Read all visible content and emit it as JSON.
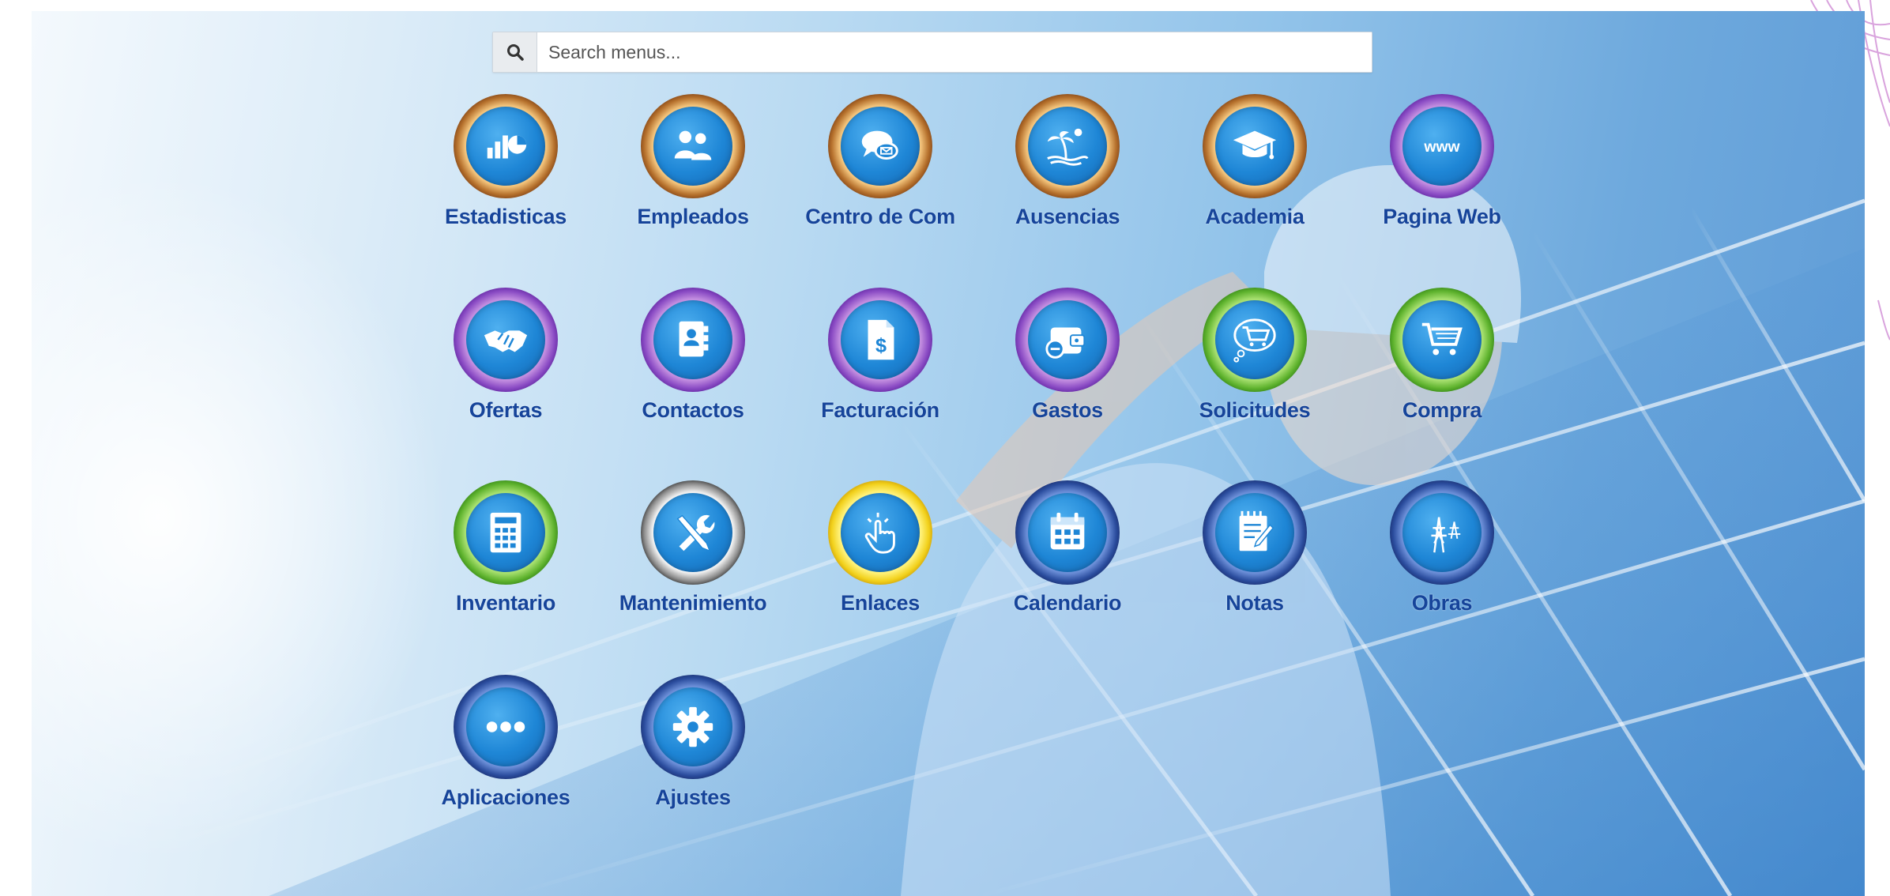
{
  "search": {
    "placeholder": "Search menus...",
    "value": ""
  },
  "apps": [
    {
      "label": "Estadisticas",
      "icon": "stats-chart-icon",
      "ring": "gold"
    },
    {
      "label": "Empleados",
      "icon": "employees-icon",
      "ring": "gold"
    },
    {
      "label": "Centro de Com",
      "icon": "chat-bubbles-icon",
      "ring": "gold"
    },
    {
      "label": "Ausencias",
      "icon": "beach-palm-icon",
      "ring": "gold"
    },
    {
      "label": "Academia",
      "icon": "graduation-cap-icon",
      "ring": "gold"
    },
    {
      "label": "Pagina Web",
      "icon": "www-icon",
      "ring": "purple"
    },
    {
      "label": "Ofertas",
      "icon": "handshake-icon",
      "ring": "purple"
    },
    {
      "label": "Contactos",
      "icon": "address-book-icon",
      "ring": "purple"
    },
    {
      "label": "Facturación",
      "icon": "invoice-dollar-icon",
      "ring": "purple"
    },
    {
      "label": "Gastos",
      "icon": "wallet-icon",
      "ring": "purple"
    },
    {
      "label": "Solicitudes",
      "icon": "cart-bubble-icon",
      "ring": "green"
    },
    {
      "label": "Compra",
      "icon": "shopping-cart-icon",
      "ring": "green"
    },
    {
      "label": "Inventario",
      "icon": "inventory-shelf-icon",
      "ring": "green"
    },
    {
      "label": "Mantenimiento",
      "icon": "tools-icon",
      "ring": "silver"
    },
    {
      "label": "Enlaces",
      "icon": "pointer-hand-icon",
      "ring": "yellow"
    },
    {
      "label": "Calendario",
      "icon": "calendar-icon",
      "ring": "navy"
    },
    {
      "label": "Notas",
      "icon": "notepad-icon",
      "ring": "navy"
    },
    {
      "label": "Obras",
      "icon": "power-tower-icon",
      "ring": "navy"
    },
    {
      "label": "Aplicaciones",
      "icon": "dots-icon",
      "ring": "navy"
    },
    {
      "label": "Ajustes",
      "icon": "gear-icon",
      "ring": "navy"
    }
  ]
}
